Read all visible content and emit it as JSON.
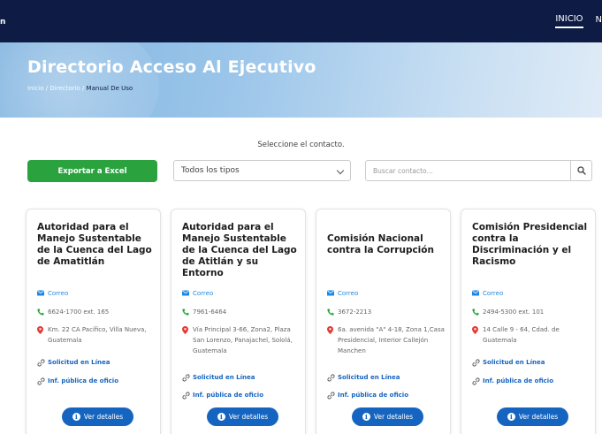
{
  "topbar": {
    "brand_stub": "n",
    "nav": [
      {
        "label": "INICIO",
        "active": true
      },
      {
        "label": "N",
        "active": false
      }
    ]
  },
  "hero": {
    "title": "Directorio Acceso Al Ejecutivo",
    "breadcrumb": [
      "Inicio",
      "Directorio",
      "Manual De Uso"
    ]
  },
  "filters": {
    "select_prompt": "Seleccione el contacto.",
    "export_label": "Exportar a Excel",
    "type_select_value": "Todos los tipos",
    "search_placeholder": "Buscar contacto..."
  },
  "cards": [
    {
      "title": "Autoridad para el Manejo Sustentable de la Cuenca del Lago de Amatitlán",
      "email": "Correo",
      "phone": "6624-1700 ext. 165",
      "address": "Km. 22 CA Pacífico, Villa Nueva, Guatemala",
      "link1": "Solicitud en Línea",
      "link2": "Inf. pública de oficio",
      "button": "Ver detalles"
    },
    {
      "title": "Autoridad para el Manejo Sustentable de la Cuenca del Lago de Atitlán y su Entorno",
      "email": "Correo",
      "phone": "7961-6464",
      "address": "Vía Principal 3-66, Zona2, Plaza San Lorenzo, Panajachel, Sololá, Guatemala",
      "link1": "Solicitud en Línea",
      "link2": "Inf. pública de oficio",
      "button": "Ver detalles"
    },
    {
      "title": "Comisión Nacional contra la Corrupción",
      "email": "Correo",
      "phone": "3672-2213",
      "address": "6a. avenida \"A\" 4-18, Zona 1,Casa Presidencial, Interior Callejón Manchen",
      "link1": "Solicitud en Línea",
      "link2": "Inf. pública de oficio",
      "button": "Ver detalles"
    },
    {
      "title": "Comisión Presidencial contra la Discriminación y el Racismo",
      "email": "Correo",
      "phone": "2494-5300 ext. 101",
      "address": "14 Calle 9 - 64, Cdad. de Guatemala",
      "link1": "Solicitud en Línea",
      "link2": "Inf. pública de oficio",
      "button": "Ver detalles"
    }
  ],
  "colors": {
    "topbar": "#0d1b45",
    "export": "#2aa33f",
    "primary": "#1565c0",
    "phone_icon": "#2aa33f",
    "pin_icon": "#e53935"
  },
  "icons": [
    "envelope-icon",
    "phone-icon",
    "map-pin-icon",
    "link-icon",
    "info-icon",
    "search-icon",
    "chevron-down-icon"
  ]
}
